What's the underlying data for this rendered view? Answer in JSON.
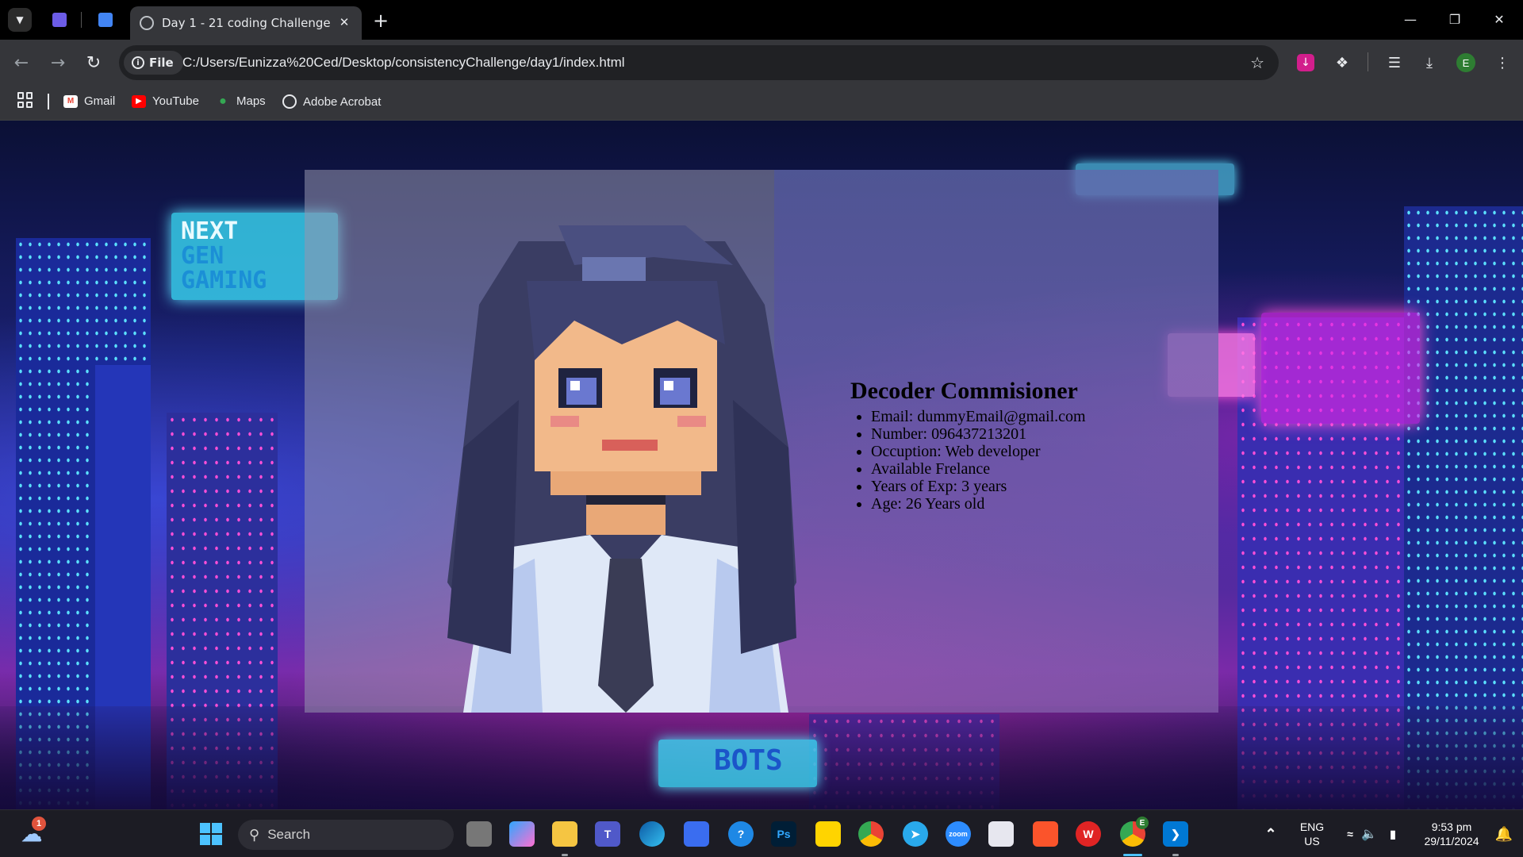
{
  "browser": {
    "tab": {
      "title": "Day 1 - 21 coding Challenge"
    },
    "address": {
      "chip_label": "File",
      "url": "C:/Users/Eunizza%20Ced/Desktop/consistencyChallenge/day1/index.html"
    },
    "profile_initial": "E",
    "bookmarks": [
      {
        "label": "Gmail",
        "icon": "gmail-icon"
      },
      {
        "label": "YouTube",
        "icon": "youtube-icon"
      },
      {
        "label": "Maps",
        "icon": "maps-icon"
      },
      {
        "label": "Adobe Acrobat",
        "icon": "acrobat-icon"
      }
    ]
  },
  "page": {
    "background_signs": {
      "next_gen_gaming": [
        "NEXT",
        "GEN",
        "GAMING"
      ],
      "bots": "BOTS"
    },
    "profile": {
      "name": "Decoder Commisioner",
      "details": [
        "Email: dummyEmail@gmail.com",
        "Number: 096437213201",
        "Occuption: Web developer",
        "Available Frelance",
        "Years of Exp: 3 years",
        "Age: 26 Years old"
      ]
    }
  },
  "taskbar": {
    "search_placeholder": "Search",
    "weather_badge": "1",
    "language": {
      "line1": "ENG",
      "line2": "US"
    },
    "clock": {
      "time": "9:53 pm",
      "date": "29/11/2024"
    },
    "chrome_profile_badge": "E"
  },
  "colors": {
    "chrome_dark": "#35363a",
    "tab_bar": "#000000",
    "neon_pink": "#ff4fd8",
    "neon_cyan": "#5be0ff",
    "card_overlay": "rgba(150,150,175,0.55)"
  }
}
